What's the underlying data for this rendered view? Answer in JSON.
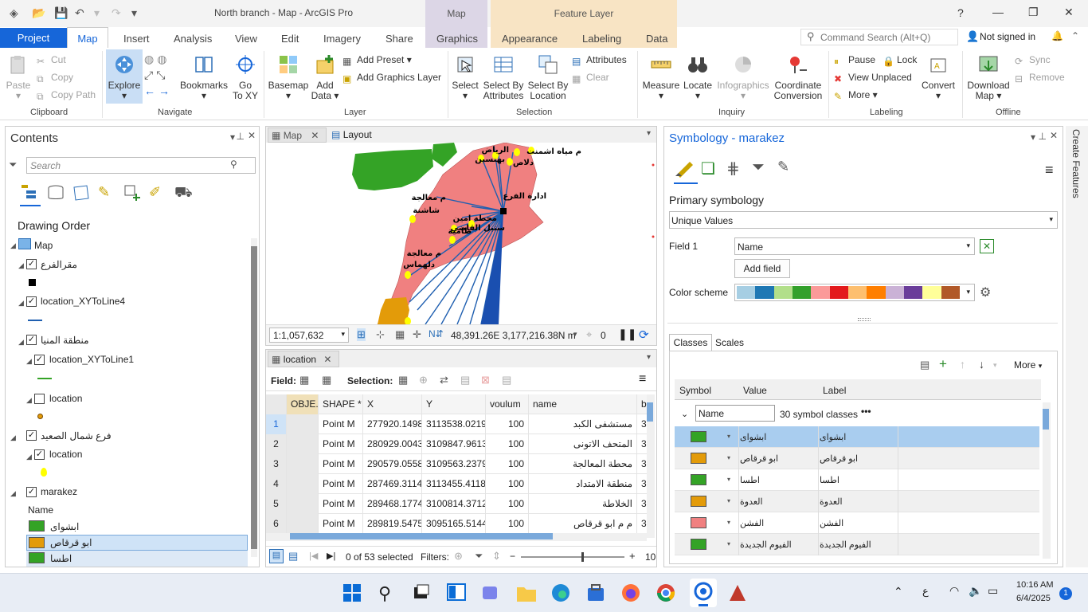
{
  "window": {
    "title": "North branch - Map - ArcGIS Pro",
    "context_map": "Map",
    "context_feature": "Feature Layer",
    "help": "?",
    "minimize": "—",
    "restore": "❐",
    "close": "✕"
  },
  "tabs": {
    "project": "Project",
    "items": [
      "Map",
      "Insert",
      "Analysis",
      "View",
      "Edit",
      "Imagery",
      "Share"
    ],
    "graphics": "Graphics",
    "appearance": "Appearance",
    "labeling": "Labeling",
    "data": "Data"
  },
  "command_search": "Command Search (Alt+Q)",
  "sign_in": "Not signed in",
  "ribbon": {
    "clipboard": {
      "paste": "Paste",
      "cut": "Cut",
      "copy": "Copy",
      "copy_path": "Copy Path",
      "group": "Clipboard"
    },
    "navigate": {
      "explore": "Explore",
      "bookmarks": "Bookmarks",
      "goto": "Go",
      "goto2": "To XY",
      "group": "Navigate"
    },
    "layer": {
      "basemap": "Basemap",
      "add": "Add",
      "add2": "Data",
      "add_preset": "Add Preset",
      "add_graphics": "Add Graphics Layer",
      "group": "Layer"
    },
    "selection": {
      "select": "Select",
      "by_attr": "Select By",
      "by_attr2": "Attributes",
      "by_loc": "Select By",
      "by_loc2": "Location",
      "attributes": "Attributes",
      "clear": "Clear",
      "group": "Selection"
    },
    "inquiry": {
      "measure": "Measure",
      "locate": "Locate",
      "infographics": "Infographics",
      "coord": "Coordinate",
      "coord2": "Conversion",
      "group": "Inquiry"
    },
    "labeling": {
      "pause": "Pause",
      "lock": "Lock",
      "view_unplaced": "View Unplaced",
      "more": "More",
      "convert": "Convert",
      "group": "Labeling"
    },
    "offline": {
      "download": "Download",
      "download2": "Map",
      "sync": "Sync",
      "remove": "Remove",
      "group": "Offline"
    }
  },
  "contents": {
    "title": "Contents",
    "search_placeholder": "Search",
    "drawing_order": "Drawing Order",
    "layers": [
      {
        "name": "Map"
      },
      {
        "name": "مقرالفرع"
      },
      {
        "name": "location_XYToLine4"
      },
      {
        "name": "منطقة المنيا"
      },
      {
        "name": "location_XYToLine1"
      },
      {
        "name": "location"
      },
      {
        "name": "فرع شمال الصعيد"
      },
      {
        "name": "location"
      },
      {
        "name": "marakez"
      }
    ],
    "field": "Name",
    "legend": [
      {
        "label": "ابشواى",
        "color": "#34a326"
      },
      {
        "label": "ابو قرقاص",
        "color": "#e39b09"
      },
      {
        "label": "اطسا",
        "color": "#34a326"
      }
    ]
  },
  "mapview": {
    "tab_map": "Map",
    "tab_layout": "Layout",
    "scale": "1:1,057,632",
    "coords": "48,391.26E 3,177,216.38N m",
    "selected": "0",
    "labels": [
      "م مياه اشمنت",
      "الرياض",
      "بهنسين",
      "دلاص",
      "ادارة الفرع",
      "م معالجة",
      "شاشنة",
      "محطة امين",
      "سنبل القاضي",
      "طامية",
      "م معالجة",
      "دلهماس"
    ]
  },
  "table": {
    "tab": "location",
    "field_label": "Field:",
    "selection_label": "Selection:",
    "columns": [
      "OBJE...",
      "SHAPE *",
      "X",
      "Y",
      "voulum",
      "name",
      "b"
    ],
    "rows": [
      {
        "id": "1",
        "shape": "Point M",
        "x": "277920.1498",
        "y": "3113538.0219",
        "voulum": "100",
        "name": "مستشفى الكبد",
        "b": "3"
      },
      {
        "id": "2",
        "shape": "Point M",
        "x": "280929.0043",
        "y": "3109847.9613",
        "voulum": "100",
        "name": "المتحف الاتونى",
        "b": "3"
      },
      {
        "id": "3",
        "shape": "Point M",
        "x": "290579.0558",
        "y": "3109563.2379",
        "voulum": "100",
        "name": "محطة المعالجة",
        "b": "3"
      },
      {
        "id": "4",
        "shape": "Point M",
        "x": "287469.3114",
        "y": "3113455.4118",
        "voulum": "100",
        "name": "منطقة الامتداد",
        "b": "3"
      },
      {
        "id": "5",
        "shape": "Point M",
        "x": "289468.1774",
        "y": "3100814.3712",
        "voulum": "100",
        "name": "الخلاطة",
        "b": "3"
      },
      {
        "id": "6",
        "shape": "Point M",
        "x": "289819.5475",
        "y": "3095165.5144",
        "voulum": "100",
        "name": "م م ابو قرقاص",
        "b": "3"
      }
    ],
    "status": "0 of 53 selected",
    "filters": "Filters:",
    "zoom": "10"
  },
  "symbology": {
    "title": "Symbology - marakez",
    "primary": "Primary symbology",
    "type": "Unique Values",
    "field1_label": "Field 1",
    "field1": "Name",
    "add_field": "Add field",
    "color_scheme_label": "Color scheme",
    "color_scheme": [
      "#a6cee3",
      "#1f78b4",
      "#b2df8a",
      "#33a02c",
      "#fb9a99",
      "#e31a1c",
      "#fdbf6f",
      "#ff7f00",
      "#cab2d6",
      "#6a3d9a",
      "#ffff99",
      "#b15928"
    ],
    "tab_classes": "Classes",
    "tab_scales": "Scales",
    "more": "More",
    "headers": [
      "Symbol",
      "Value",
      "Label"
    ],
    "group_field": "Name",
    "classes_count": "30 symbol classes",
    "rows": [
      {
        "value": "ابشواى",
        "label": "ابشواى",
        "color": "#34a326"
      },
      {
        "value": "ابو قرقاص",
        "label": "ابو قرقاص",
        "color": "#e39b09"
      },
      {
        "value": "اطسا",
        "label": "اطسا",
        "color": "#34a326"
      },
      {
        "value": "العدوة",
        "label": "العدوة",
        "color": "#e39b09"
      },
      {
        "value": "الفشن",
        "label": "الفشن",
        "color": "#f08080"
      },
      {
        "value": "الفيوم الجديدة",
        "label": "الفيوم الجديدة",
        "color": "#34a326"
      }
    ]
  },
  "side_tab": "Create Features",
  "taskbar": {
    "time": "10:16 AM",
    "date": "6/4/2025",
    "lang": "ع",
    "notif": "1"
  }
}
